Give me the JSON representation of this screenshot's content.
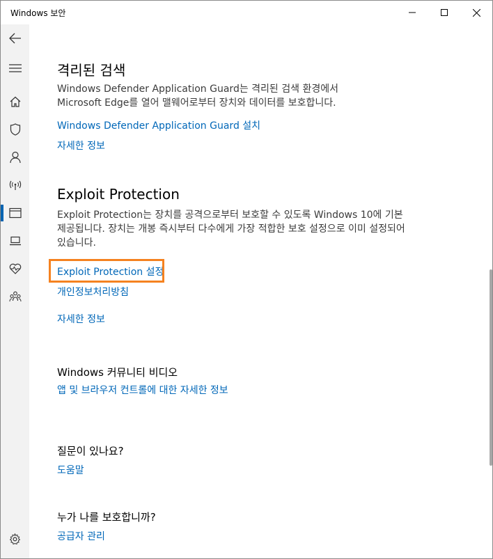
{
  "window": {
    "title": "Windows 보안"
  },
  "nav": {
    "items": [
      {
        "name": "back-icon"
      },
      {
        "name": "menu-icon"
      },
      {
        "name": "home-icon"
      },
      {
        "name": "shield-icon"
      },
      {
        "name": "person-icon"
      },
      {
        "name": "wireless-icon"
      },
      {
        "name": "app-browser-icon",
        "active": true
      },
      {
        "name": "laptop-icon"
      },
      {
        "name": "heart-pulse-icon"
      },
      {
        "name": "family-icon"
      },
      {
        "name": "gear-icon"
      }
    ]
  },
  "isolated_browsing": {
    "heading": "격리된 검색",
    "description": "Windows Defender Application Guard는 격리된 검색 환경에서 Microsoft Edge를 열어 맬웨어로부터 장치와 데이터를 보호합니다.",
    "install_link": "Windows Defender Application Guard 설치",
    "more_info_link": "자세한 정보"
  },
  "exploit_protection": {
    "heading": "Exploit Protection",
    "description": "Exploit Protection는 장치를 공격으로부터 보호할 수 있도록 Windows 10에 기본 제공됩니다. 장치는 개봉 즉시부터 다수에게 가장 적합한 보호 설정으로 이미 설정되어 있습니다.",
    "settings_link": "Exploit Protection 설정",
    "privacy_link": "개인정보처리방침",
    "more_info_link": "자세한 정보"
  },
  "community": {
    "heading": "Windows 커뮤니티 비디오",
    "link": "앱 및 브라우저 컨트롤에 대한 자세한 정보"
  },
  "questions": {
    "heading": "질문이 있나요?",
    "link": "도움말"
  },
  "protector": {
    "heading": "누가 나를 보호합니까?",
    "link": "공급자 관리"
  },
  "colors": {
    "accent": "#0067b8",
    "highlight": "#f58220",
    "rail": "#f2f2f2"
  }
}
